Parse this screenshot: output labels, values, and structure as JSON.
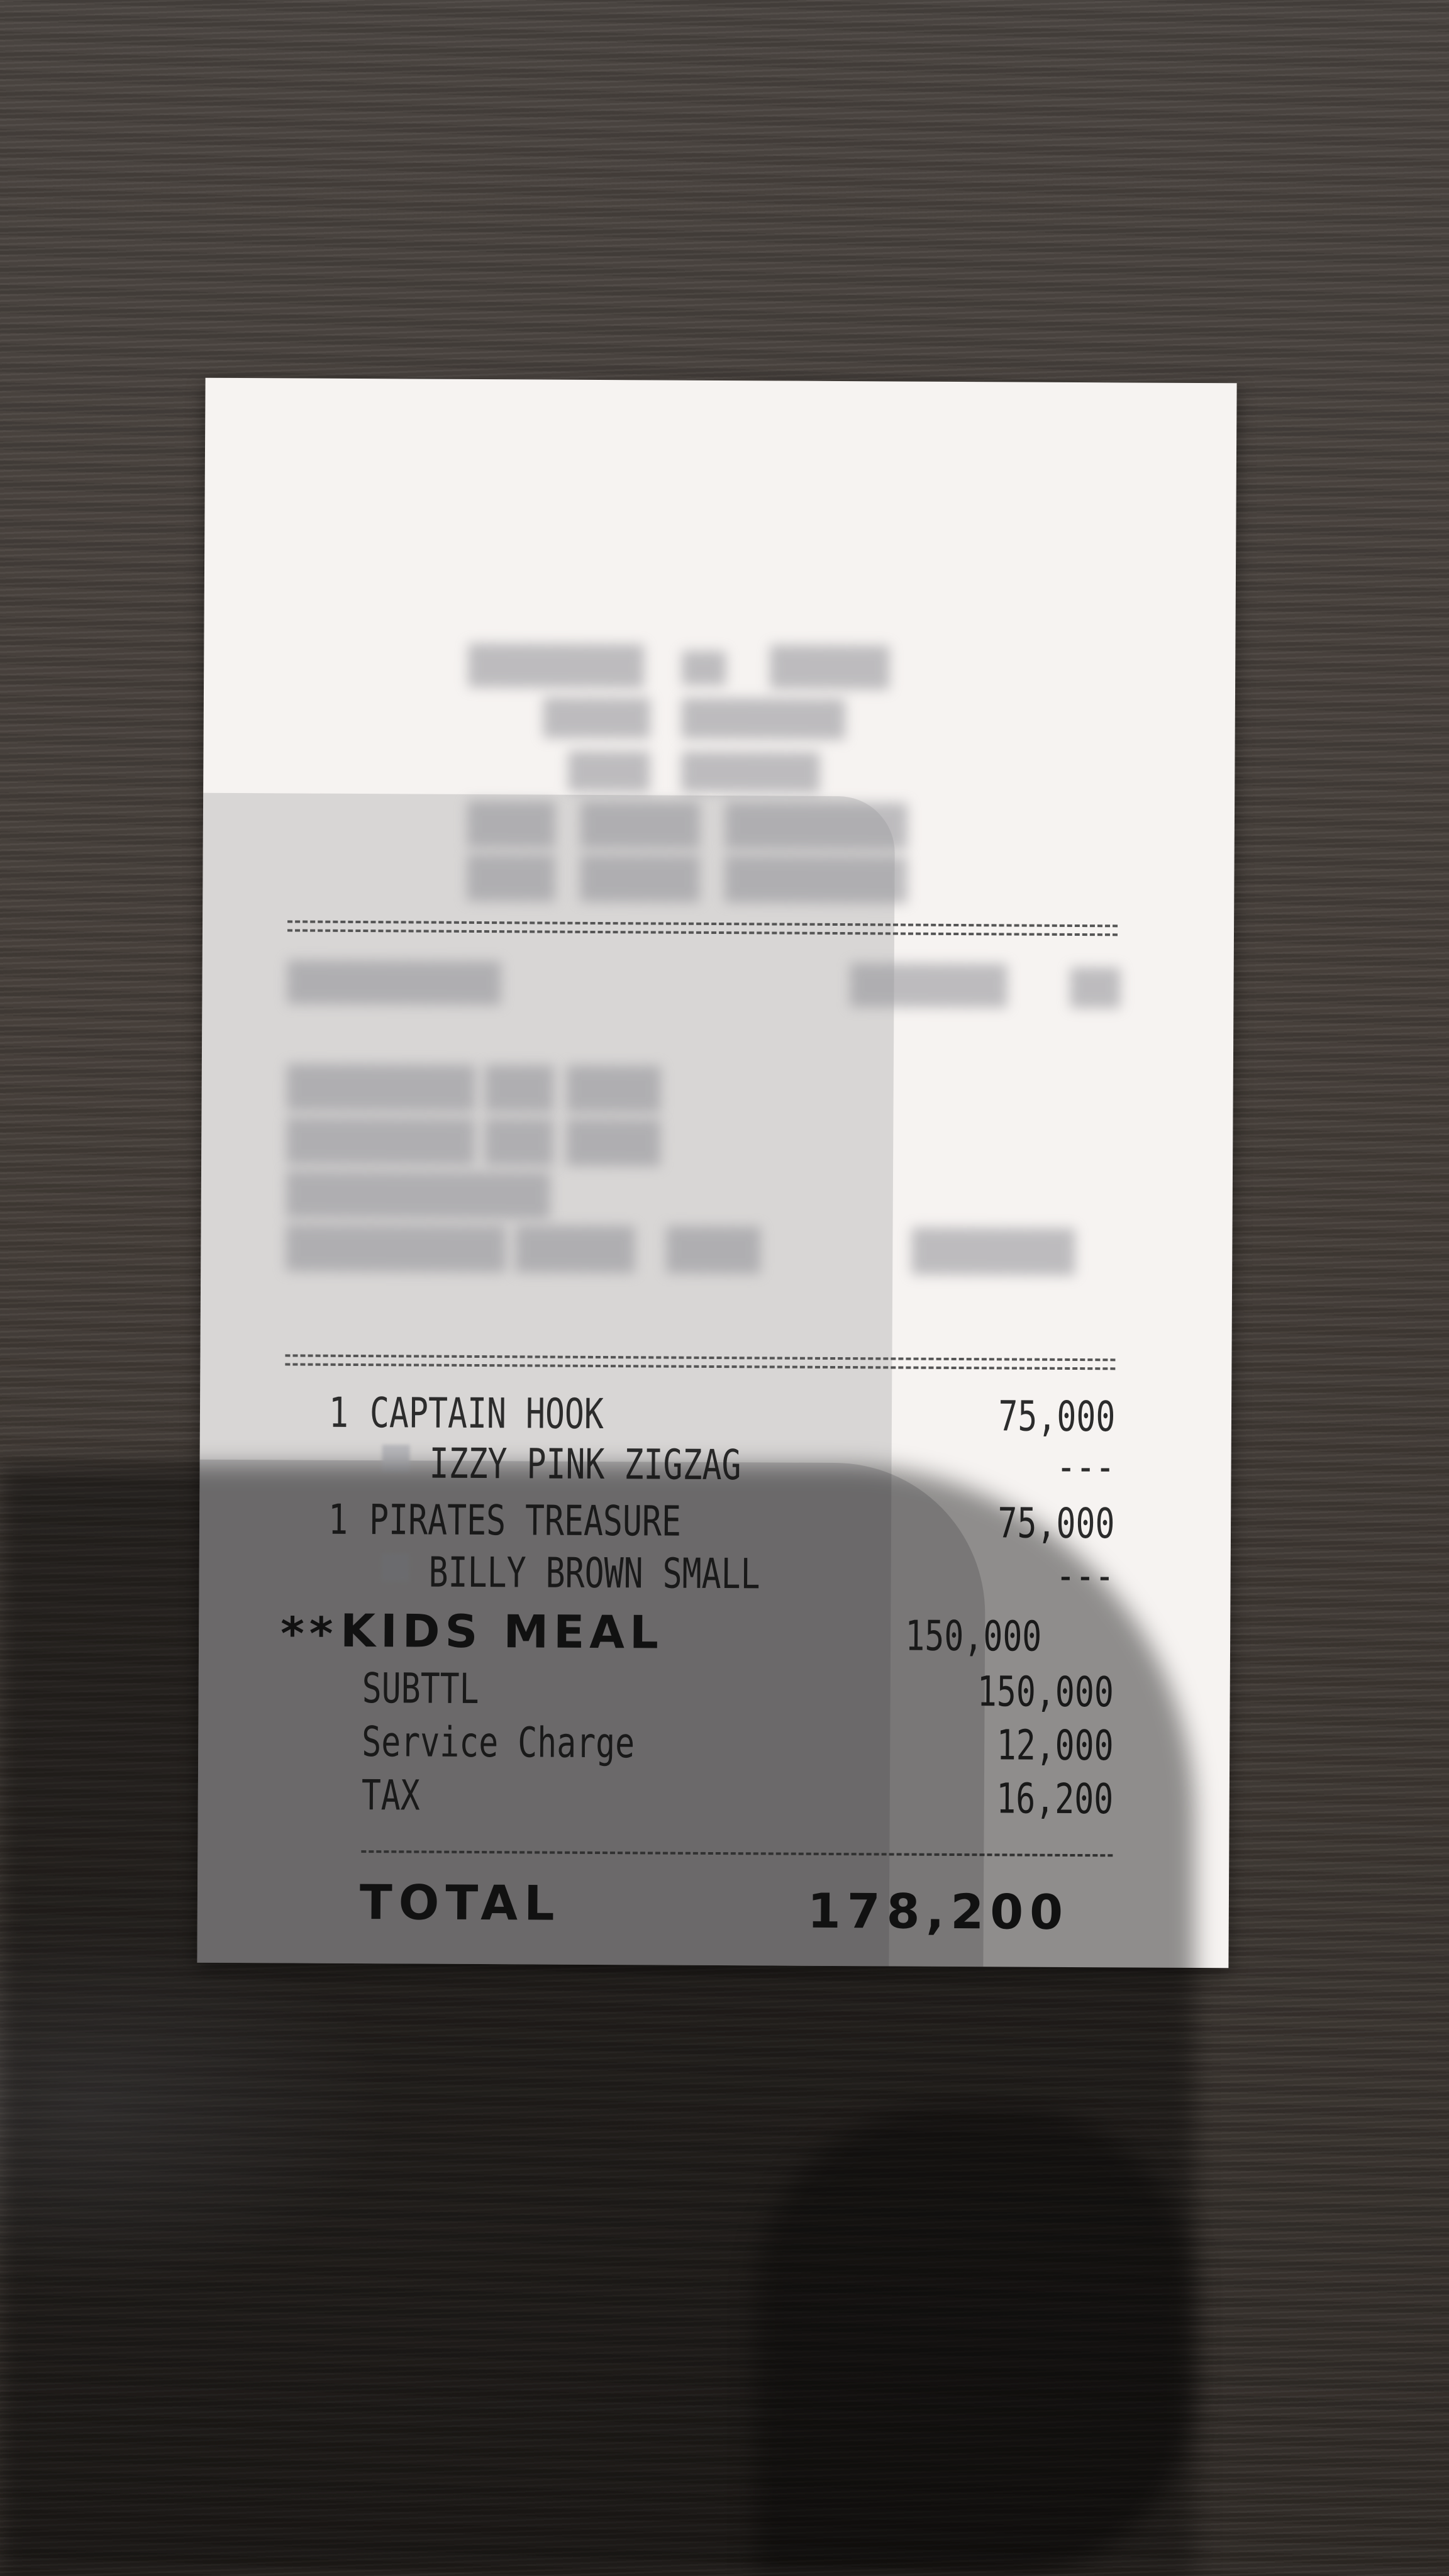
{
  "receipt": {
    "items": [
      {
        "qty": "1",
        "name": "CAPTAIN HOOK",
        "price": "75,000",
        "modifier": "IZZY PINK ZIGZAG",
        "modifier_price": "---"
      },
      {
        "qty": "1",
        "name": "PIRATES TREASURE",
        "price": "75,000",
        "modifier": "BILLY BROWN SMALL",
        "modifier_price": "---"
      }
    ],
    "group": {
      "marker": "**",
      "name": "KIDS MEAL",
      "amount": "150,000"
    },
    "summary": {
      "subtotal_label": "SUBTTL",
      "subtotal": "150,000",
      "service_label": "Service Charge",
      "service": "12,000",
      "tax_label": "TAX",
      "tax": "16,200"
    },
    "total": {
      "label": "TOTAL",
      "amount": "178,200"
    }
  }
}
